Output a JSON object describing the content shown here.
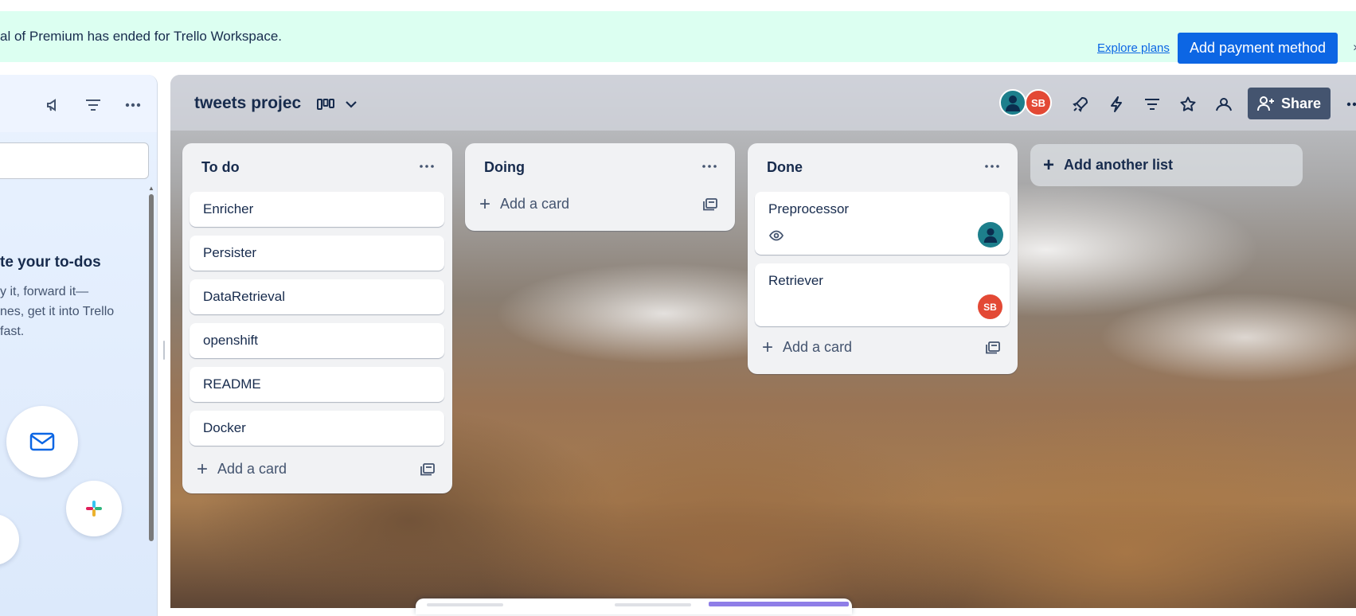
{
  "banner": {
    "message": "al of Premium has ended for Trello Workspace.",
    "explore_link": "Explore plans",
    "payment_button": "Add payment method",
    "close_glyph": "×"
  },
  "left_panel": {
    "icons": [
      "megaphone-icon",
      "filter-icon",
      "more-icon"
    ],
    "title": "te your to-dos",
    "description": "y it, forward it—\nnes, get it into Trello\n fast.",
    "integration_icons": [
      "mail-icon",
      "slack-icon"
    ]
  },
  "board": {
    "title": "tweets projec",
    "avatars": [
      {
        "initials": "",
        "color": "#1d7f8c",
        "icon": "person-icon"
      },
      {
        "initials": "SB",
        "color": "#e34935"
      }
    ],
    "header_icons": [
      "board-view-icon",
      "chevron-down-icon",
      "power-ups-icon",
      "automation-icon",
      "filter-icon",
      "star-icon",
      "visibility-icon",
      "more-icon"
    ],
    "share_label": "Share",
    "add_list_label": "Add another list",
    "lists": [
      {
        "title": "To do",
        "cards": [
          "Enricher",
          "Persister",
          "DataRetrieval",
          "openshift",
          "README",
          "Docker"
        ],
        "add_card_label": "Add a card"
      },
      {
        "title": "Doing",
        "cards": [],
        "add_card_label": "Add a card"
      },
      {
        "title": "Done",
        "cards": [
          {
            "name": "Preprocessor",
            "watching": true,
            "member_icon": "person-icon",
            "member_color": "#1d7f8c"
          },
          {
            "name": "Retriever",
            "member_initials": "SB",
            "member_color": "#e34935"
          }
        ],
        "add_card_label": "Add a card"
      }
    ]
  },
  "colors": {
    "banner_bg": "#dcfff1",
    "primary_blue": "#0c66e4",
    "text_dark": "#172b4d",
    "share_bg": "#44546f",
    "list_bg": "#f1f2f4"
  }
}
